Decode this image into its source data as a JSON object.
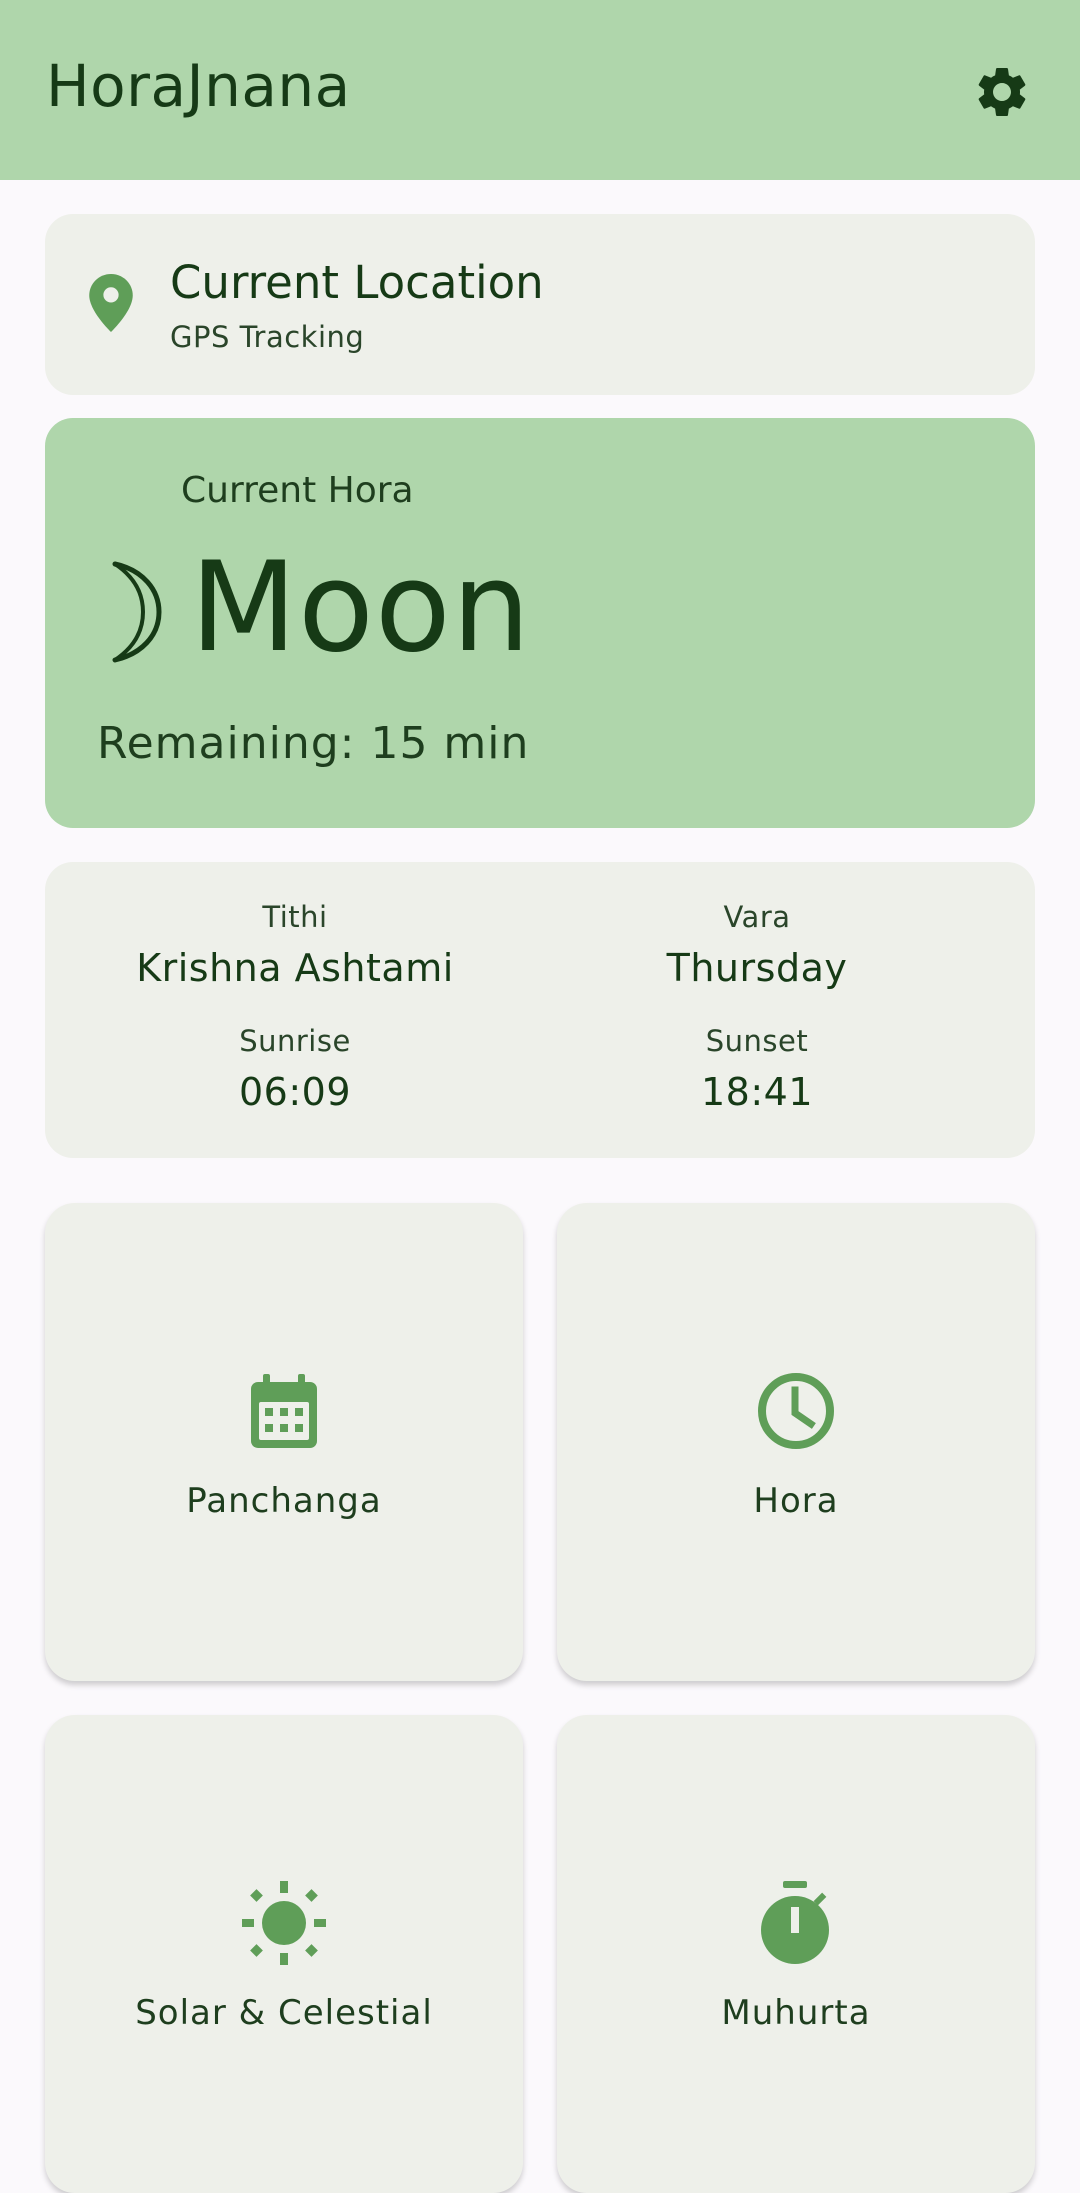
{
  "app": {
    "title": "HoraJnana"
  },
  "header": {
    "settings_icon": "gear-icon"
  },
  "location": {
    "title": "Current Location",
    "subtitle": "GPS Tracking",
    "icon": "location-pin-icon"
  },
  "hora": {
    "label": "Current Hora",
    "planet": "Moon",
    "remaining": "Remaining: 15 min",
    "symbol_icon": "crescent-moon-icon"
  },
  "panchanga_summary": {
    "tithi_label": "Tithi",
    "tithi_value": "Krishna Ashtami",
    "vara_label": "Vara",
    "vara_value": "Thursday",
    "sunrise_label": "Sunrise",
    "sunrise_value": "06:09",
    "sunset_label": "Sunset",
    "sunset_value": "18:41"
  },
  "tiles": [
    {
      "label": "Panchanga",
      "icon": "calendar-icon"
    },
    {
      "label": "Hora",
      "icon": "clock-icon"
    },
    {
      "label": "Solar & Celestial",
      "icon": "sun-icon"
    },
    {
      "label": "Muhurta",
      "icon": "timer-icon"
    }
  ],
  "colors": {
    "primary_container": "#afd6ab",
    "surface_variant": "#eef0ea",
    "icon_green": "#5f9e58",
    "on_surface": "#163a16",
    "background": "#fbf9fc"
  }
}
